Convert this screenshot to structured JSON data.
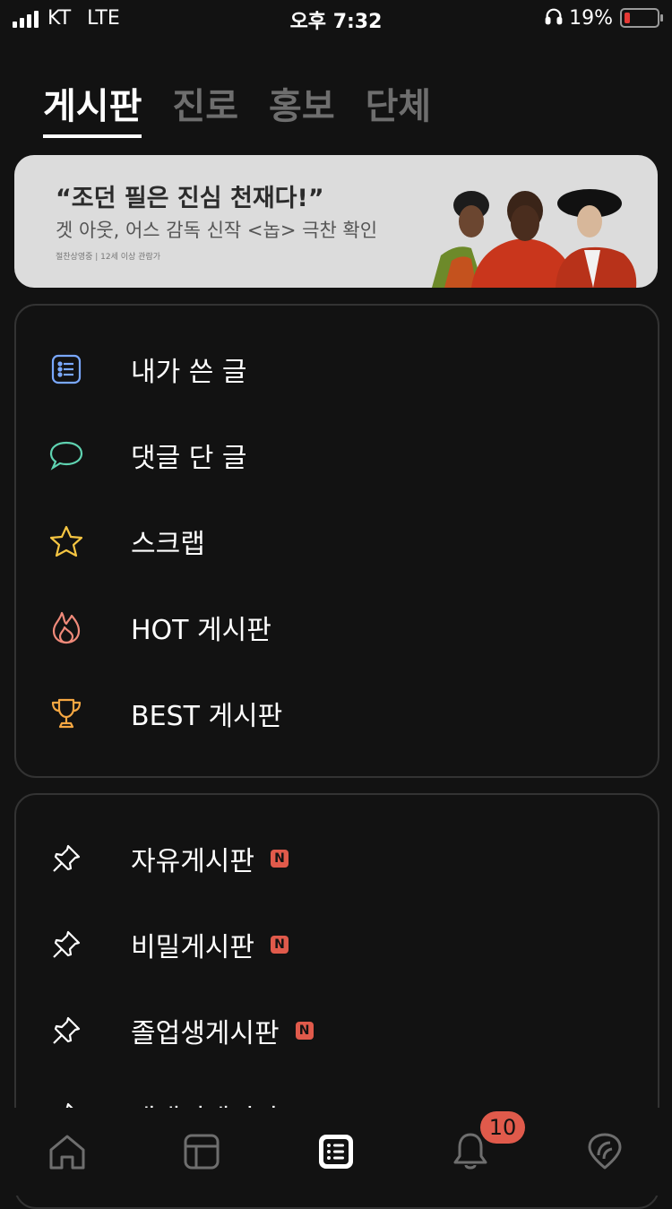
{
  "status_bar": {
    "carrier": "KT",
    "network": "LTE",
    "time": "오후 7:32",
    "battery": "19%",
    "battery_level": 0.19
  },
  "tabs": [
    {
      "label": "게시판",
      "active": true
    },
    {
      "label": "진로",
      "active": false
    },
    {
      "label": "홍보",
      "active": false
    },
    {
      "label": "단체",
      "active": false
    }
  ],
  "banner": {
    "headline": "“조던 필은 진심 천재다!”",
    "subtitle": "겟 아웃, 어스 감독 신작 <놉> 극찬 확인",
    "fine_print": "절찬상영중 | 12세 이상 관람가"
  },
  "my_menu": [
    {
      "label": "내가 쓴 글",
      "icon": "list-icon",
      "color": "#7aa8ff"
    },
    {
      "label": "댓글 단 글",
      "icon": "comment-icon",
      "color": "#5fd3b1"
    },
    {
      "label": "스크랩",
      "icon": "star-icon",
      "color": "#f5c542"
    },
    {
      "label": "HOT 게시판",
      "icon": "fire-icon",
      "color": "#f08a7a"
    },
    {
      "label": "BEST 게시판",
      "icon": "trophy-icon",
      "color": "#f5a742"
    }
  ],
  "boards": [
    {
      "label": "자유게시판",
      "badge": "N",
      "icon": "pin-icon"
    },
    {
      "label": "비밀게시판",
      "badge": "N",
      "icon": "pin-icon"
    },
    {
      "label": "졸업생게시판",
      "badge": "N",
      "icon": "pin-icon"
    },
    {
      "label": "새내기게시판",
      "badge": "N",
      "icon": "pin-icon"
    }
  ],
  "bottom_nav": {
    "items": [
      {
        "name": "home-icon",
        "active": false
      },
      {
        "name": "timetable-icon",
        "active": false
      },
      {
        "name": "board-icon",
        "active": true
      },
      {
        "name": "bell-icon",
        "active": false
      },
      {
        "name": "campus-pick-icon",
        "active": false
      }
    ],
    "notification_count": "10"
  },
  "colors": {
    "background": "#121212",
    "accent": "#e05a4b",
    "inactive": "#6e6e6e"
  }
}
